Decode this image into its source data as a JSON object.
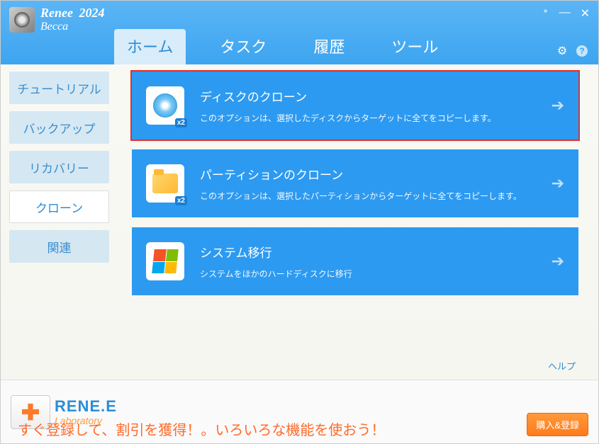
{
  "brand": {
    "name": "Renee",
    "year": "2024",
    "sub": "Becca"
  },
  "nav": {
    "home": "ホーム",
    "task": "タスク",
    "history": "履歴",
    "tool": "ツール"
  },
  "sidebar": {
    "tutorial": "チュートリアル",
    "backup": "バックアップ",
    "recovery": "リカバリー",
    "clone": "クローン",
    "related": "関連"
  },
  "options": {
    "disk": {
      "title": "ディスクのクローン",
      "desc": "このオプションは、選択したディスクからターゲットに全てをコピーします。",
      "badge": "x2"
    },
    "partition": {
      "title": "パーティションのクローン",
      "desc": "このオプションは、選択したパーティションからターゲットに全てをコピーします。",
      "badge": "x2"
    },
    "system": {
      "title": "システム移行",
      "desc": "システムをほかのハードディスクに移行"
    }
  },
  "help_link": "ヘルプ",
  "footer": {
    "brand": "RENE.E",
    "lab": "Laboratory",
    "promo": "すぐ登録して、割引を獲得！。いろいろな機能を使おう！",
    "buy": "購入&登録"
  }
}
